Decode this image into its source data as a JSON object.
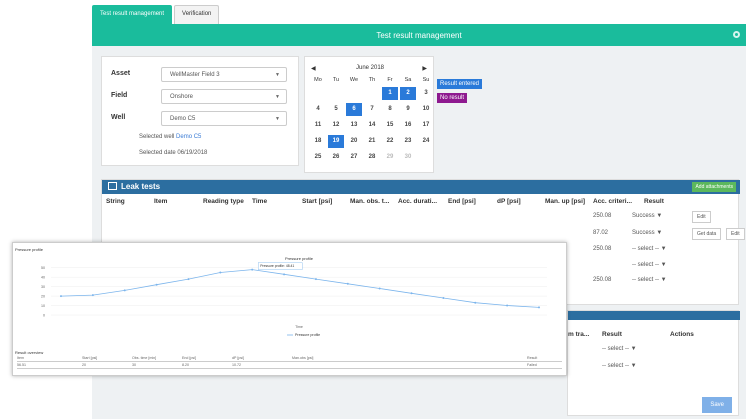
{
  "tabs": [
    {
      "label": "Test result management"
    },
    {
      "label": "Verification"
    }
  ],
  "header": {
    "title": "Test result management"
  },
  "form": {
    "asset_label": "Asset",
    "asset_value": "WellMaster Field 3",
    "field_label": "Field",
    "field_value": "Onshore",
    "well_label": "Well",
    "well_value": "Demo C5",
    "selected_well_prefix": "Selected well",
    "selected_well": "Demo C5",
    "selected_date": "Selected date 06/19/2018"
  },
  "calendar": {
    "month": "June 2018",
    "dow": [
      "Mo",
      "Tu",
      "We",
      "Th",
      "Fr",
      "Sa",
      "Su"
    ],
    "weeks": [
      [
        "",
        "",
        "",
        "",
        "1",
        "2",
        "3"
      ],
      [
        "4",
        "5",
        "6",
        "7",
        "8",
        "9",
        "10"
      ],
      [
        "11",
        "12",
        "13",
        "14",
        "15",
        "16",
        "17"
      ],
      [
        "18",
        "19",
        "20",
        "21",
        "22",
        "23",
        "24"
      ],
      [
        "25",
        "26",
        "27",
        "28",
        "29",
        "30",
        ""
      ]
    ],
    "legend_entered": "Result entered",
    "legend_none": "No result",
    "color_entered": "#2a7ad9",
    "color_none": "#8e1a8f"
  },
  "leak": {
    "title": "Leak tests",
    "attach": "Add attachments",
    "columns": [
      "String",
      "Item",
      "Reading type",
      "Time",
      "Start [psi]",
      "Man. obs. t...",
      "Acc. durati...",
      "End [psi]",
      "dP [psi]",
      "Man. up [psi]",
      "Acc. criteri...",
      "Result"
    ],
    "rows": [
      {
        "acc": "250.08",
        "result": "Success",
        "b1": "Edit",
        "b2": ""
      },
      {
        "acc": "87.02",
        "result": "Success",
        "b1": "Get data",
        "b2": "Edit"
      },
      {
        "acc": "250.08",
        "result": "-- select --",
        "b1": "",
        "b2": ""
      },
      {
        "acc": "",
        "result": "-- select --",
        "b1": "",
        "b2": ""
      },
      {
        "acc": "250.08",
        "result": "-- select --",
        "b1": "",
        "b2": ""
      }
    ]
  },
  "panel2": {
    "col1": "m tra...",
    "col2": "Result",
    "col3": "Actions",
    "rows": [
      "-- select --",
      "-- select --"
    ],
    "save": "Save"
  },
  "popup": {
    "title": "Pressure profile",
    "result_overview": "Result overview",
    "table_headers": [
      "Item",
      "Start [psi]",
      "Obs. time [min]",
      "End [psi]",
      "dP [psi]",
      "Man.obs [psi]",
      "Result"
    ],
    "table_values": [
      "56.51",
      "20",
      "30",
      "8.20",
      "10.72",
      "",
      "Failed"
    ]
  },
  "chart_data": {
    "type": "line",
    "title": "Pressure profile",
    "xlabel": "Time",
    "ylabel": "",
    "legend": "top-center",
    "series": [
      {
        "name": "Pressure profile",
        "color": "#7cb5ec",
        "values": [
          20,
          21,
          26,
          32,
          38,
          45,
          48,
          43,
          38,
          33,
          28,
          23,
          18,
          13,
          10,
          8
        ]
      }
    ],
    "ylim": [
      0,
      55
    ],
    "yticks": [
      "0",
      "10",
      "20",
      "30",
      "40",
      "50"
    ],
    "tooltip": "Pressure profile: 48.41"
  }
}
